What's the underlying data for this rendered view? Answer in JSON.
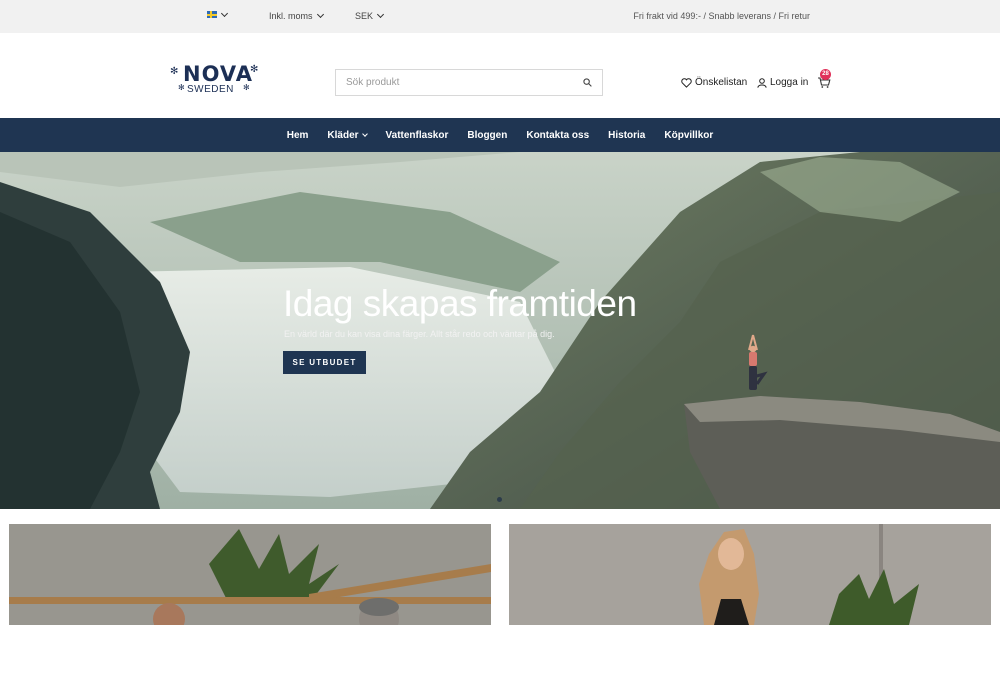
{
  "topbar": {
    "flag": "sweden-flag-icon",
    "vat_label": "Inkl. moms",
    "currency_label": "SEK",
    "promo_text": "Fri frakt vid 499:- / Snabb leverans / Fri retur"
  },
  "header": {
    "logo_text": "NOVA",
    "logo_subtext": "SWEDEN",
    "search_placeholder": "Sök produkt",
    "wishlist_label": "Önskelistan",
    "login_label": "Logga in",
    "cart_count": "28"
  },
  "nav": {
    "items": [
      "Hem",
      "Kläder",
      "Vattenflaskor",
      "Bloggen",
      "Kontakta oss",
      "Historia",
      "Köpvillkor"
    ]
  },
  "hero": {
    "title": "Idag skapas framtiden",
    "subtitle": "En värld där du kan visa dina färger. Allt står redo och väntar på dig.",
    "cta_label": "SE UTBUDET"
  },
  "colors": {
    "nav_bg": "#1f3552",
    "topbar_bg": "#f1f1f1",
    "badge": "#e0315a",
    "brand": "#1c2f55"
  }
}
